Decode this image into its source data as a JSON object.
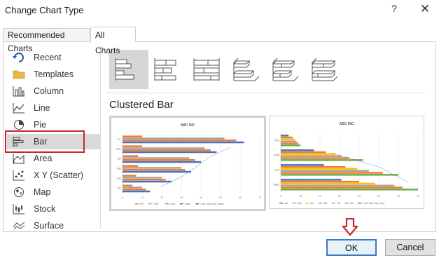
{
  "dialog": {
    "title": "Change Chart Type",
    "help_label": "?",
    "close_label": "✕"
  },
  "tabs": [
    {
      "label": "Recommended Charts"
    },
    {
      "label": "All Charts"
    }
  ],
  "sidebar": {
    "items": [
      {
        "label": "Recent",
        "icon": "recent-icon"
      },
      {
        "label": "Templates",
        "icon": "folder-icon"
      },
      {
        "label": "Column",
        "icon": "column-chart-icon"
      },
      {
        "label": "Line",
        "icon": "line-chart-icon"
      },
      {
        "label": "Pie",
        "icon": "pie-chart-icon"
      },
      {
        "label": "Bar",
        "icon": "bar-chart-icon",
        "selected": true
      },
      {
        "label": "Area",
        "icon": "area-chart-icon"
      },
      {
        "label": "X Y (Scatter)",
        "icon": "scatter-chart-icon"
      },
      {
        "label": "Map",
        "icon": "map-chart-icon"
      },
      {
        "label": "Stock",
        "icon": "stock-chart-icon"
      },
      {
        "label": "Surface",
        "icon": "surface-chart-icon"
      }
    ]
  },
  "subtypes": [
    "clustered-bar-icon",
    "stacked-bar-icon",
    "100-stacked-bar-icon",
    "3d-clustered-bar-icon",
    "3d-stacked-bar-icon",
    "3d-100-stacked-bar-icon"
  ],
  "main": {
    "chart_type_name": "Clustered Bar"
  },
  "footer": {
    "ok_label": "OK",
    "cancel_label": "Cancel"
  },
  "colors": {
    "accent": "#3b78c3",
    "highlight": "#c8262e",
    "orange": "#ed7d31",
    "gray": "#a5a5a5",
    "yellow": "#ffc000",
    "blue": "#4472c4",
    "green": "#70ad47"
  },
  "chart_data": [
    {
      "type": "bar",
      "title": "ABC INC",
      "categories": [
        "Jun",
        "May",
        "Apr",
        "Mar",
        "Feb",
        "Jan"
      ],
      "series": [
        {
          "name": "ROI",
          "values": [
            10,
            10,
            8,
            8,
            7,
            5
          ]
        },
        {
          "name": "Profit",
          "values": [
            52,
            42,
            34,
            30,
            20,
            10
          ]
        },
        {
          "name": "Cost",
          "values": [
            58,
            45,
            37,
            32,
            22,
            12
          ]
        },
        {
          "name": "Sales",
          "values": [
            62,
            48,
            40,
            35,
            25,
            14
          ]
        },
        {
          "name": "2 per. Mov. Avg. (Sales)"
        }
      ],
      "xticks": [
        "0",
        "10",
        "20",
        "30",
        "40",
        "50",
        "60",
        "70"
      ],
      "xlim": [
        0,
        70
      ]
    },
    {
      "type": "bar",
      "title": "ABC INC",
      "categories": [
        "ROI",
        "Profit",
        "Cost",
        "Sales"
      ],
      "series": [
        {
          "name": "Jan",
          "values": [
            4,
            17,
            22,
            31
          ]
        },
        {
          "name": "May",
          "values": [
            6,
            23,
            33,
            40
          ]
        },
        {
          "name": "Apr",
          "values": [
            7,
            28,
            39,
            48
          ]
        },
        {
          "name": "Mar",
          "values": [
            8,
            31,
            45,
            58
          ]
        },
        {
          "name": "Feb",
          "values": [
            9,
            35,
            52,
            62
          ]
        },
        {
          "name": "Jun",
          "values": [
            10,
            42,
            60,
            70
          ]
        },
        {
          "name": "2 per. Mov. Avg. (Jun)"
        }
      ],
      "xticks": [
        "0",
        "10",
        "20",
        "30",
        "40",
        "50",
        "60",
        "70"
      ],
      "xlim": [
        0,
        70
      ]
    }
  ]
}
